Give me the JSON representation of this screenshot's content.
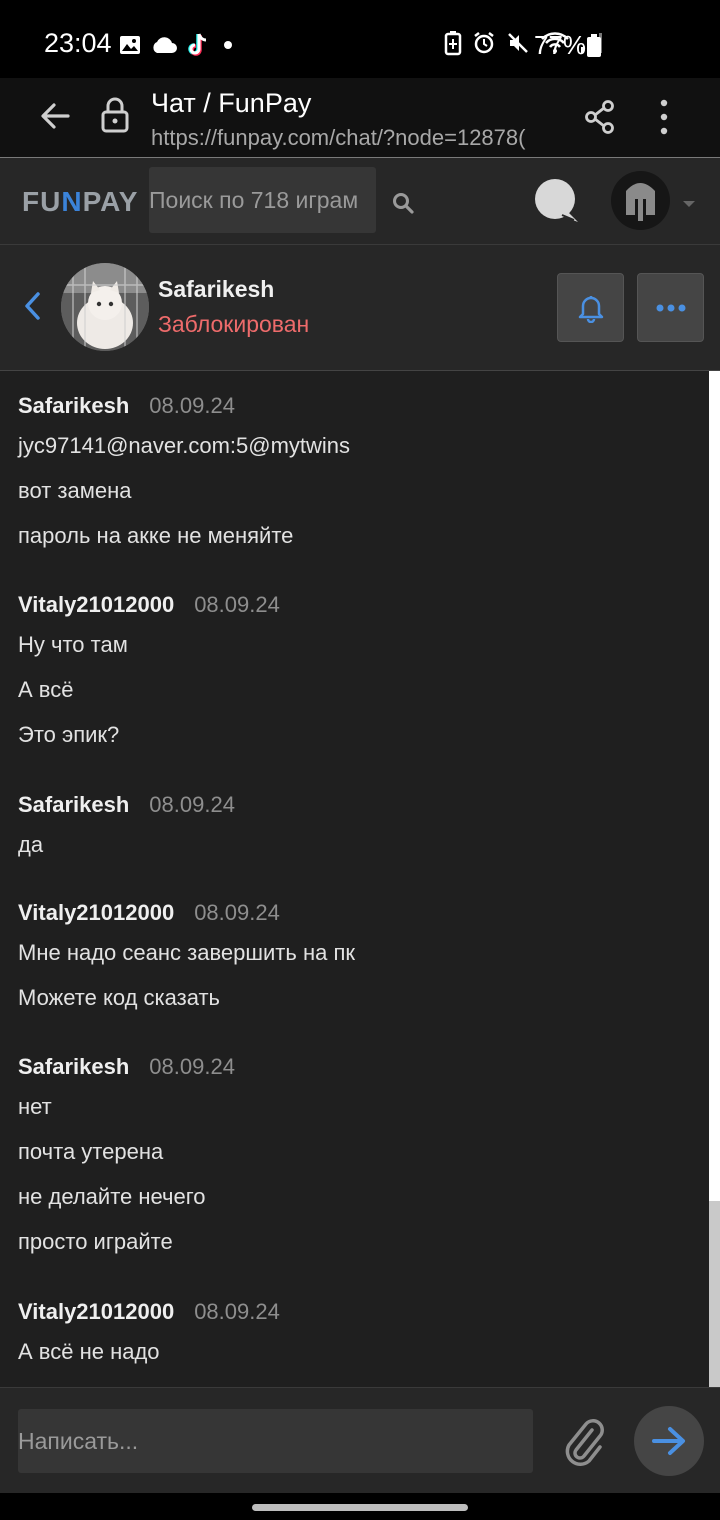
{
  "status_bar": {
    "time": "23:04",
    "battery": "77%",
    "icons_left": [
      "gallery-icon",
      "cloud-icon",
      "tiktok-icon",
      "dot-icon"
    ],
    "icons_right": [
      "battery-saver-icon",
      "alarm-icon",
      "mute-icon",
      "wifi-icon",
      "signal-icon"
    ]
  },
  "browser": {
    "title": "Чат / FunPay",
    "url": "https://funpay.com/chat/?node=12878("
  },
  "site_header": {
    "logo_left": "FU",
    "logo_mid": "N",
    "logo_right": "PAY",
    "search_placeholder": "Поиск по 718 играм"
  },
  "chat_header": {
    "name": "Safarikesh",
    "status": "Заблокирован"
  },
  "messages": [
    {
      "author": "Safarikesh",
      "date": "08.09.24",
      "lines": [
        "jyc97141@naver.com:5@mytwins",
        "вот замена",
        "пароль на акке не меняйте"
      ]
    },
    {
      "author": "Vitaly21012000",
      "date": "08.09.24",
      "lines": [
        "Ну что там",
        "А всё",
        "Это эпик?"
      ]
    },
    {
      "author": "Safarikesh",
      "date": "08.09.24",
      "lines": [
        "да"
      ]
    },
    {
      "author": "Vitaly21012000",
      "date": "08.09.24",
      "lines": [
        "Мне надо сеанс завершить на пк",
        "Можете код сказать"
      ]
    },
    {
      "author": "Safarikesh",
      "date": "08.09.24",
      "lines": [
        "нет",
        "почта утерена",
        "не делайте нечего",
        "просто играйте"
      ]
    },
    {
      "author": "Vitaly21012000",
      "date": "08.09.24",
      "lines": [
        "А всё не надо"
      ]
    }
  ],
  "composer": {
    "placeholder": "Написать..."
  },
  "colors": {
    "accent_blue": "#3b83d9",
    "blocked_red": "#ee6b6b",
    "panel": "#272727",
    "chat_bg": "#1f1f1f"
  }
}
